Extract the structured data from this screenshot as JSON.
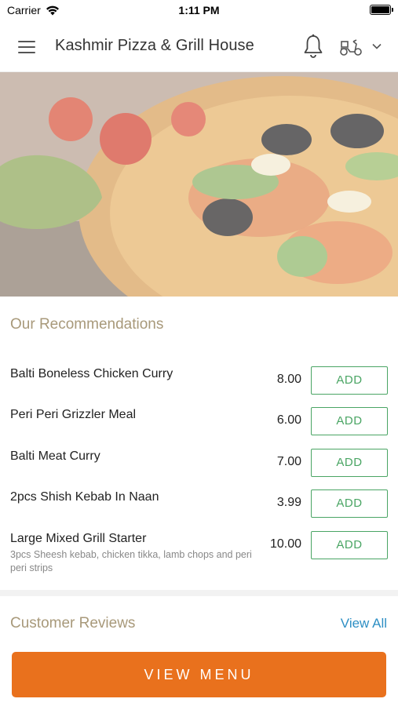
{
  "status_bar": {
    "carrier": "Carrier",
    "time": "1:11 PM"
  },
  "header": {
    "title": "Kashmir Pizza & Grill House"
  },
  "recommendations": {
    "title": "Our Recommendations",
    "items": [
      {
        "name": "Balti Boneless Chicken Curry",
        "price": "8.00",
        "description": "",
        "add_label": "ADD"
      },
      {
        "name": "Peri Peri Grizzler Meal",
        "price": "6.00",
        "description": "",
        "add_label": "ADD"
      },
      {
        "name": "Balti Meat Curry",
        "price": "7.00",
        "description": "",
        "add_label": "ADD"
      },
      {
        "name": "2pcs Shish Kebab In Naan",
        "price": "3.99",
        "description": "",
        "add_label": "ADD"
      },
      {
        "name": "Large Mixed Grill Starter",
        "price": "10.00",
        "description": "3pcs Sheesh kebab, chicken tikka, lamb chops and peri peri strips",
        "add_label": "ADD"
      }
    ]
  },
  "reviews": {
    "title": "Customer Reviews",
    "view_all_label": "View All"
  },
  "cta": {
    "label": "VIEW MENU"
  },
  "colors": {
    "accent_orange": "#e9711d",
    "add_green": "#4aa564",
    "link_blue": "#2e8fc4",
    "section_title": "#a8997a"
  }
}
